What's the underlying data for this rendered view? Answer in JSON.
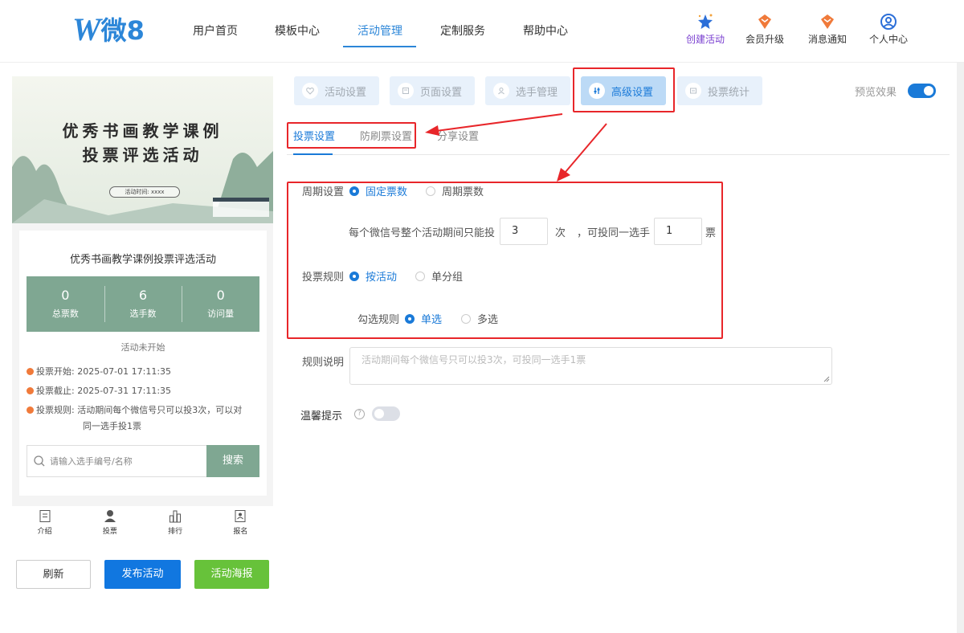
{
  "header": {
    "logo_text": "微8",
    "nav": [
      "用户首页",
      "模板中心",
      "活动管理",
      "定制服务",
      "帮助中心"
    ],
    "nav_active": "活动管理",
    "tools": [
      "创建活动",
      "会员升级",
      "消息通知",
      "个人中心"
    ]
  },
  "phone": {
    "banner_line1": "优秀书画教学课例",
    "banner_line2": "投票评选活动",
    "banner_pill": "活动时间: xxxx",
    "card_title": "优秀书画教学课例投票评选活动",
    "stats": [
      {
        "value": "0",
        "label": "总票数"
      },
      {
        "value": "6",
        "label": "选手数"
      },
      {
        "value": "0",
        "label": "访问量"
      }
    ],
    "status": "活动未开始",
    "vote_start": "投票开始: 2025-07-01 17:11:35",
    "vote_end": "投票截止: 2025-07-31 17:11:35",
    "vote_rule_1": "投票规则: 活动期间每个微信号只可以投3次，可以对",
    "vote_rule_2": "同一选手投1票",
    "search_placeholder": "请输入选手编号/名称",
    "search_button": "搜索",
    "tabbar": [
      "介绍",
      "投票",
      "排行",
      "报名"
    ]
  },
  "actions": {
    "refresh": "刷新",
    "publish": "发布活动",
    "poster": "活动海报"
  },
  "settings_tabs": [
    "活动设置",
    "页面设置",
    "选手管理",
    "高级设置",
    "投票统计"
  ],
  "settings_tab_active": "高级设置",
  "preview_label": "预览效果",
  "sub_tabs": [
    "投票设置",
    "防刷票设置",
    "分享设置"
  ],
  "sub_tab_active": "投票设置",
  "form": {
    "period_label": "周期设置",
    "period_options": [
      "固定票数",
      "周期票数"
    ],
    "period_selected": "固定票数",
    "limit_prefix": "每个微信号整个活动期间只能投",
    "limit_times": "3",
    "limit_times_unit": "次",
    "limit_mid": "，可投同一选手",
    "limit_votes": "1",
    "limit_votes_unit": "票",
    "rule_label": "投票规则",
    "rule_options": [
      "按活动",
      "单分组"
    ],
    "rule_selected": "按活动",
    "check_label": "勾选规则",
    "check_options": [
      "单选",
      "多选"
    ],
    "check_selected": "单选",
    "desc_label": "规则说明",
    "desc_placeholder": "活动期间每个微信号只可以投3次，可投同一选手1票",
    "tip_label": "温馨提示",
    "tip_enabled": false
  },
  "colors": {
    "primary": "#1a7ad8",
    "green": "#7fa792",
    "annotation": "#e8262a"
  }
}
